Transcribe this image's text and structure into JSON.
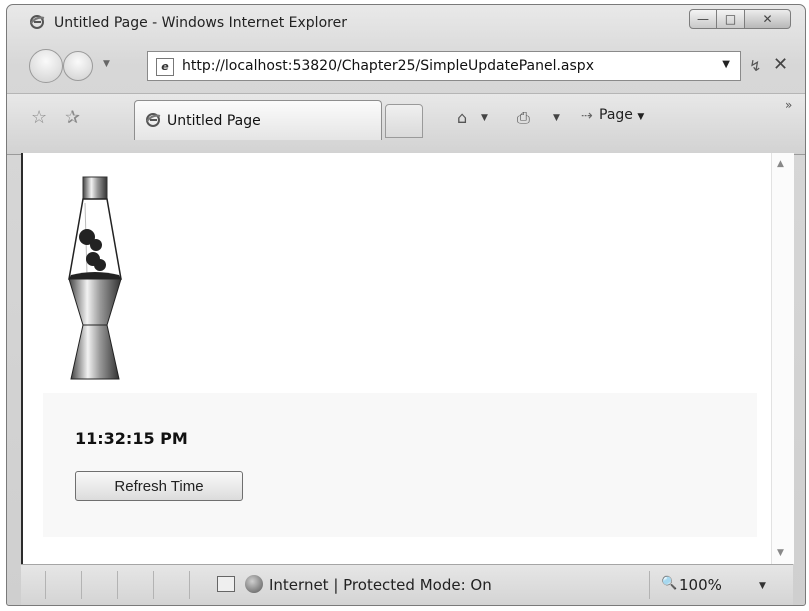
{
  "window": {
    "title": "Untitled Page - Windows Internet Explorer",
    "minimize_glyph": "—",
    "maximize_glyph": "□",
    "close_glyph": "✕"
  },
  "address_bar": {
    "url": "http://localhost:53820/Chapter25/SimpleUpdatePanel.aspx",
    "page_icon": "e",
    "dropdown_glyph": "▼",
    "refresh_glyph": "↯",
    "stop_glyph": "✕"
  },
  "tabs": [
    {
      "label": "Untitled Page"
    }
  ],
  "command_bar": {
    "home_glyph": "⌂",
    "print_glyph": "⎙",
    "page_label": "Page",
    "dropdown_glyph": "▼",
    "more_glyph": "»"
  },
  "content": {
    "time": "11:32:15 PM",
    "refresh_button_label": "Refresh Time"
  },
  "status_bar": {
    "zone_text": "Internet | Protected Mode: On",
    "zoom": "100%",
    "zoom_icon": "🔍"
  },
  "icons": {
    "title": "ie-icon",
    "favorites": "star-icon",
    "add_favorites": "add-star-icon",
    "lamp": "lava-lamp-image"
  }
}
